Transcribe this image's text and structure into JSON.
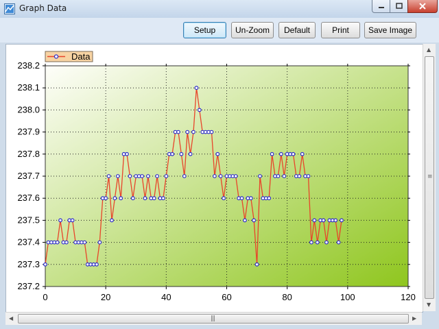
{
  "window": {
    "title": "Graph Data",
    "icon": "chart-app-icon"
  },
  "toolbar": {
    "setup_label": "Setup",
    "unzoom_label": "Un-Zoom",
    "default_label": "Default",
    "print_label": "Print",
    "save_label": "Save Image"
  },
  "colors": {
    "line": "#e8442a",
    "marker": "#2b2bc8",
    "plot_bg_light": "#fefefa",
    "plot_bg_dark": "#8fc61e"
  },
  "chart_data": {
    "type": "line",
    "title": "",
    "xlabel": "",
    "ylabel": "",
    "xlim": [
      0,
      120
    ],
    "ylim": [
      237.2,
      238.2
    ],
    "x_ticks": [
      "0",
      "20",
      "40",
      "60",
      "80",
      "100",
      "120"
    ],
    "y_ticks": [
      "237.2",
      "237.3",
      "237.4",
      "237.5",
      "237.6",
      "237.7",
      "237.8",
      "237.9",
      "238.0",
      "238.1",
      "238.2"
    ],
    "grid": true,
    "legend_position": "top-left",
    "series": [
      {
        "name": "Data",
        "x": [
          0,
          1,
          2,
          3,
          4,
          5,
          6,
          7,
          8,
          9,
          10,
          11,
          12,
          13,
          14,
          15,
          16,
          17,
          18,
          19,
          20,
          21,
          22,
          23,
          24,
          25,
          26,
          27,
          28,
          29,
          30,
          31,
          32,
          33,
          34,
          35,
          36,
          37,
          38,
          39,
          40,
          41,
          42,
          43,
          44,
          45,
          46,
          47,
          48,
          49,
          50,
          51,
          52,
          53,
          54,
          55,
          56,
          57,
          58,
          59,
          60,
          61,
          62,
          63,
          64,
          65,
          66,
          67,
          68,
          69,
          70,
          71,
          72,
          73,
          74,
          75,
          76,
          77,
          78,
          79,
          80,
          81,
          82,
          83,
          84,
          85,
          86,
          87,
          88,
          89,
          90,
          91,
          92,
          93,
          94,
          95,
          96,
          97,
          98
        ],
        "values": [
          237.3,
          237.4,
          237.4,
          237.4,
          237.4,
          237.5,
          237.4,
          237.4,
          237.5,
          237.5,
          237.4,
          237.4,
          237.4,
          237.4,
          237.3,
          237.3,
          237.3,
          237.3,
          237.4,
          237.6,
          237.6,
          237.7,
          237.5,
          237.6,
          237.7,
          237.6,
          237.8,
          237.8,
          237.7,
          237.6,
          237.7,
          237.7,
          237.7,
          237.6,
          237.7,
          237.6,
          237.6,
          237.7,
          237.6,
          237.6,
          237.7,
          237.8,
          237.8,
          237.9,
          237.9,
          237.8,
          237.7,
          237.9,
          237.8,
          237.9,
          238.1,
          238.0,
          237.9,
          237.9,
          237.9,
          237.9,
          237.7,
          237.8,
          237.7,
          237.6,
          237.7,
          237.7,
          237.7,
          237.7,
          237.6,
          237.6,
          237.5,
          237.6,
          237.6,
          237.5,
          237.3,
          237.7,
          237.6,
          237.6,
          237.6,
          237.8,
          237.7,
          237.7,
          237.8,
          237.7,
          237.8,
          237.8,
          237.8,
          237.7,
          237.7,
          237.8,
          237.7,
          237.7,
          237.4,
          237.5,
          237.4,
          237.5,
          237.5,
          237.4,
          237.5,
          237.5,
          237.5,
          237.4,
          237.5
        ]
      }
    ]
  }
}
